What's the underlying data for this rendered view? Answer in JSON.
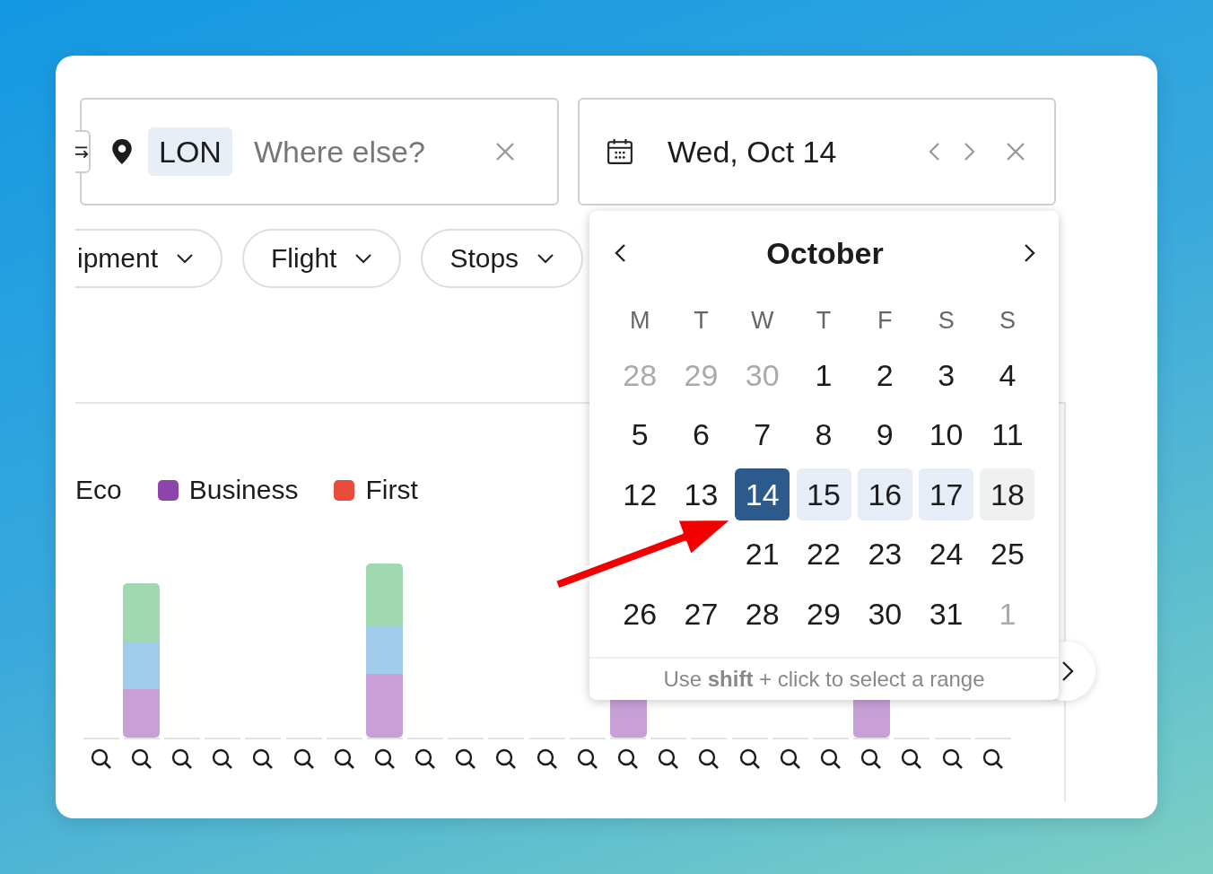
{
  "origin": {
    "selected_place": "LON",
    "placeholder": "Where else?"
  },
  "date": {
    "value": "Wed, Oct 14"
  },
  "filters": [
    {
      "label": "ipment"
    },
    {
      "label": "Flight"
    },
    {
      "label": "Stops"
    }
  ],
  "legend": [
    {
      "label": "Eco"
    },
    {
      "label": "Business",
      "color": "#8e44ad"
    },
    {
      "label": "First",
      "color": "#e74c3c"
    }
  ],
  "calendar": {
    "month": "October",
    "weekdays": [
      "M",
      "T",
      "W",
      "T",
      "F",
      "S",
      "S"
    ],
    "weeks": [
      [
        {
          "kind": "day",
          "label": "28",
          "muted": true,
          "selected": false,
          "in_range": false,
          "hovered": false
        },
        {
          "kind": "day",
          "label": "29",
          "muted": true,
          "selected": false,
          "in_range": false,
          "hovered": false
        },
        {
          "kind": "day",
          "label": "30",
          "muted": true,
          "selected": false,
          "in_range": false,
          "hovered": false
        },
        {
          "kind": "day",
          "label": "1",
          "muted": false,
          "selected": false,
          "in_range": false,
          "hovered": false
        },
        {
          "kind": "day",
          "label": "2",
          "muted": false,
          "selected": false,
          "in_range": false,
          "hovered": false
        },
        {
          "kind": "day",
          "label": "3",
          "muted": false,
          "selected": false,
          "in_range": false,
          "hovered": false
        },
        {
          "kind": "day",
          "label": "4",
          "muted": false,
          "selected": false,
          "in_range": false,
          "hovered": false
        }
      ],
      [
        {
          "kind": "day",
          "label": "5",
          "muted": false,
          "selected": false,
          "in_range": false,
          "hovered": false
        },
        {
          "kind": "day",
          "label": "6",
          "muted": false,
          "selected": false,
          "in_range": false,
          "hovered": false
        },
        {
          "kind": "day",
          "label": "7",
          "muted": false,
          "selected": false,
          "in_range": false,
          "hovered": false
        },
        {
          "kind": "day",
          "label": "8",
          "muted": false,
          "selected": false,
          "in_range": false,
          "hovered": false
        },
        {
          "kind": "day",
          "label": "9",
          "muted": false,
          "selected": false,
          "in_range": false,
          "hovered": false
        },
        {
          "kind": "day",
          "label": "10",
          "muted": false,
          "selected": false,
          "in_range": false,
          "hovered": false
        },
        {
          "kind": "day",
          "label": "11",
          "muted": false,
          "selected": false,
          "in_range": false,
          "hovered": false
        }
      ],
      [
        {
          "kind": "day",
          "label": "12",
          "muted": false,
          "selected": false,
          "in_range": false,
          "hovered": false
        },
        {
          "kind": "day",
          "label": "13",
          "muted": false,
          "selected": false,
          "in_range": false,
          "hovered": false
        },
        {
          "kind": "day",
          "label": "14",
          "muted": false,
          "selected": true,
          "in_range": false,
          "hovered": false
        },
        {
          "kind": "day",
          "label": "15",
          "muted": false,
          "selected": false,
          "in_range": true,
          "hovered": false
        },
        {
          "kind": "day",
          "label": "16",
          "muted": false,
          "selected": false,
          "in_range": true,
          "hovered": false
        },
        {
          "kind": "day",
          "label": "17",
          "muted": false,
          "selected": false,
          "in_range": true,
          "hovered": false
        },
        {
          "kind": "day",
          "label": "18",
          "muted": false,
          "selected": false,
          "in_range": false,
          "hovered": true
        }
      ],
      [
        {
          "kind": "covered"
        },
        {
          "kind": "covered"
        },
        {
          "kind": "day",
          "label": "21",
          "muted": false,
          "selected": false,
          "in_range": false,
          "hovered": false
        },
        {
          "kind": "day",
          "label": "22",
          "muted": false,
          "selected": false,
          "in_range": false,
          "hovered": false
        },
        {
          "kind": "day",
          "label": "23",
          "muted": false,
          "selected": false,
          "in_range": false,
          "hovered": false
        },
        {
          "kind": "day",
          "label": "24",
          "muted": false,
          "selected": false,
          "in_range": false,
          "hovered": false
        },
        {
          "kind": "day",
          "label": "25",
          "muted": false,
          "selected": false,
          "in_range": false,
          "hovered": false
        }
      ],
      [
        {
          "kind": "day",
          "label": "26",
          "muted": false,
          "selected": false,
          "in_range": false,
          "hovered": false
        },
        {
          "kind": "day",
          "label": "27",
          "muted": false,
          "selected": false,
          "in_range": false,
          "hovered": false
        },
        {
          "kind": "day",
          "label": "28",
          "muted": false,
          "selected": false,
          "in_range": false,
          "hovered": false
        },
        {
          "kind": "day",
          "label": "29",
          "muted": false,
          "selected": false,
          "in_range": false,
          "hovered": false
        },
        {
          "kind": "day",
          "label": "30",
          "muted": false,
          "selected": false,
          "in_range": false,
          "hovered": false
        },
        {
          "kind": "day",
          "label": "31",
          "muted": false,
          "selected": false,
          "in_range": false,
          "hovered": false
        },
        {
          "kind": "day",
          "label": "1",
          "muted": true,
          "selected": false,
          "in_range": false,
          "hovered": false
        }
      ]
    ],
    "hint": "Use **shift** + click to select a range"
  }
}
